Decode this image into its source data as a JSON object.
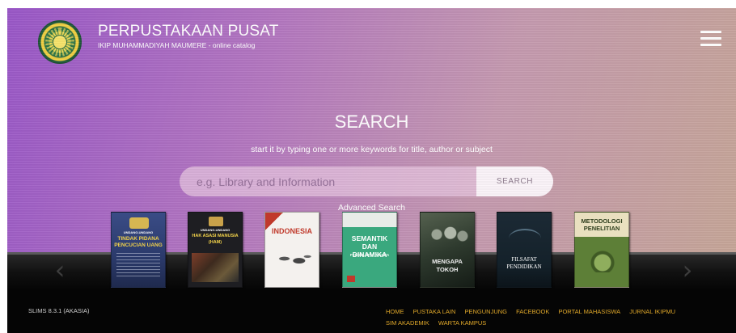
{
  "header": {
    "title": "PERPUSTAKAAN PUSAT",
    "subtitle": "IKIP MUHAMMADIYAH MAUMERE - online catalog"
  },
  "search": {
    "heading": "SEARCH",
    "description": "start it by typing one or more keywords for title, author or subject",
    "placeholder": "e.g. Library and Information",
    "button_label": "SEARCH",
    "advanced_label": "Advanced Search"
  },
  "books": [
    {
      "title": "TINDAK PIDANA PENCUCIAN UANG",
      "top_label": "UNDANG-UNDANG",
      "color": "#2b3a6b"
    },
    {
      "title": "HAK ASASI MANUSIA (HAM)",
      "top_label": "UNDANG-UNDANG",
      "color": "#1e1e22"
    },
    {
      "title": "INDONESIA",
      "top_label": "",
      "color": "#f4f1ee"
    },
    {
      "title": "SEMANTIK DAN DINAMIKA",
      "top_label": "PERGULATAN MAKNA",
      "color": "#3aa87e"
    },
    {
      "title": "MENGAPA TOKOH",
      "top_label": "",
      "color": "#2e3a2e"
    },
    {
      "title": "FILSAFAT PENDIDIKAN",
      "top_label": "",
      "color": "#14212a"
    },
    {
      "title": "METODOLOGI PENELITIAN",
      "top_label": "",
      "color": "#5d7f37"
    }
  ],
  "footer": {
    "version": "SLIMS 8.3.1 (AKASIA)",
    "links": [
      "HOME",
      "PUSTAKA LAIN",
      "PENGUNJUNG",
      "FACEBOOK",
      "PORTAL MAHASISWA",
      "JURNAL IKIPMU",
      "SIM AKADEMIK",
      "WARTA KAMPUS"
    ]
  },
  "icons": {
    "menu": "hamburger-menu-icon",
    "prev": "chevron-left-icon",
    "next": "chevron-right-icon"
  },
  "colors": {
    "hero_start": "#9a58c8",
    "hero_end": "#c6a698",
    "footer_link": "#e0a82a"
  }
}
